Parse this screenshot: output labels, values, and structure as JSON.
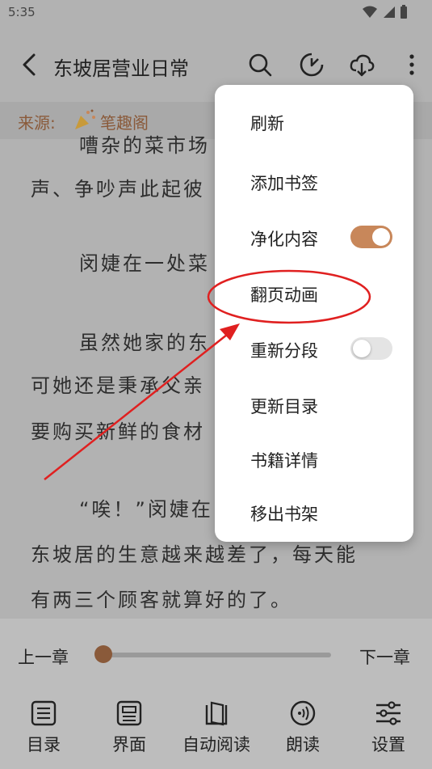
{
  "status": {
    "time": "5:35"
  },
  "header": {
    "title": "东坡居营业日常",
    "icons": [
      "back-arrow-icon",
      "search-icon",
      "clock-icon",
      "cloud-download-icon",
      "more-vertical-icon"
    ]
  },
  "source": {
    "label": "来源:",
    "name": "笔趣阁"
  },
  "content": {
    "lines": [
      "嘈杂的菜市场",
      "声、争吵声此起彼",
      "闵婕在一处菜",
      "虽然她家的东",
      "可她还是秉承父亲",
      "要购买新鲜的食材",
      "“唉！”闵婕在",
      "东坡居的生意越来越差了，每天能",
      "有两三个顾客就算好的了。"
    ]
  },
  "menu": {
    "items": [
      {
        "label": "刷新"
      },
      {
        "label": "添加书签"
      },
      {
        "label": "净化内容",
        "toggle": true,
        "on": true
      },
      {
        "label": "翻页动画"
      },
      {
        "label": "重新分段",
        "toggle": true,
        "on": false
      },
      {
        "label": "更新目录"
      },
      {
        "label": "书籍详情"
      },
      {
        "label": "移出书架"
      }
    ]
  },
  "reader": {
    "prev_chapter": "上一章",
    "next_chapter": "下一章",
    "progress": 0
  },
  "bottom_nav": [
    {
      "label": "目录",
      "icon": "list-icon"
    },
    {
      "label": "界面",
      "icon": "layout-icon"
    },
    {
      "label": "自动阅读",
      "icon": "book-icon"
    },
    {
      "label": "朗读",
      "icon": "audio-icon"
    },
    {
      "label": "设置",
      "icon": "sliders-icon"
    }
  ],
  "colors": {
    "accent": "#c8875a",
    "annotation": "#e02020",
    "menu_bg": "#ffffff",
    "overlay": "#b2b2b2"
  }
}
